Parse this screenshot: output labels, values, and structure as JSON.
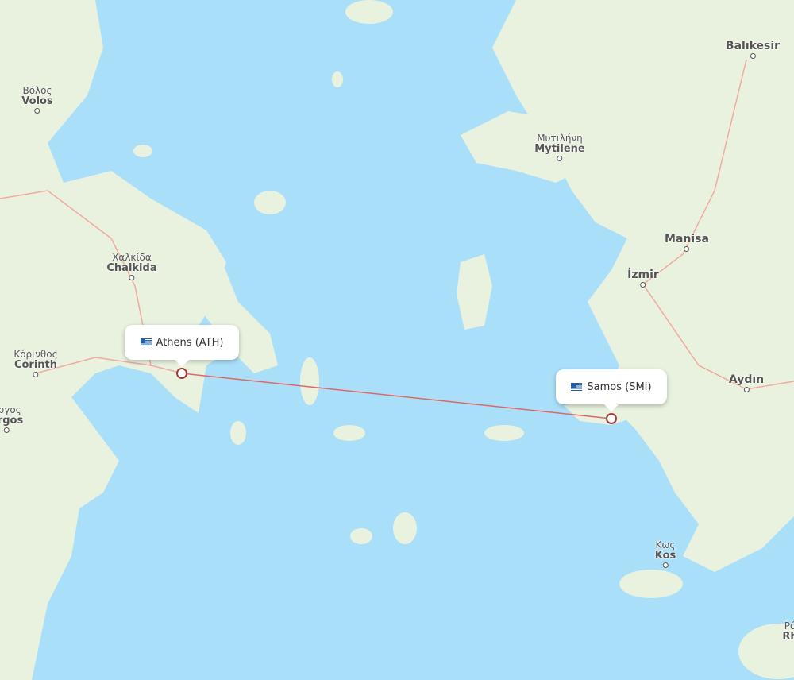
{
  "map": {
    "route": {
      "from": {
        "name": "Athens",
        "code": "ATH",
        "label": "Athens (ATH)",
        "country_flag": "greece-flag-icon"
      },
      "to": {
        "name": "Samos",
        "code": "SMI",
        "label": "Samos (SMI)",
        "country_flag": "greece-flag-icon"
      },
      "line_color": "#e06666"
    },
    "colors": {
      "sea": "#aadff9",
      "land": "#e8f2df",
      "roads": "#f2a9a0",
      "pin": "#a33a3a"
    },
    "cities": [
      {
        "id": "volos",
        "local": "Βόλος",
        "name": "Volos"
      },
      {
        "id": "chalkida",
        "local": "Χαλκίδα",
        "name": "Chalkida"
      },
      {
        "id": "corinth",
        "local": "Κόρινθος",
        "name": "Corinth"
      },
      {
        "id": "argos",
        "local": "Άργος",
        "name": "Argos"
      },
      {
        "id": "mytilene",
        "local": "Μυτιλήνη",
        "name": "Mytilene"
      },
      {
        "id": "balikesir",
        "local": "",
        "name": "Balıkesir"
      },
      {
        "id": "manisa",
        "local": "",
        "name": "Manisa"
      },
      {
        "id": "izmir",
        "local": "",
        "name": "İzmir"
      },
      {
        "id": "aydin",
        "local": "",
        "name": "Aydın"
      },
      {
        "id": "kos",
        "local": "Κως",
        "name": "Kos"
      },
      {
        "id": "rhodes",
        "local": "Ρό",
        "name": "Rh"
      }
    ]
  }
}
